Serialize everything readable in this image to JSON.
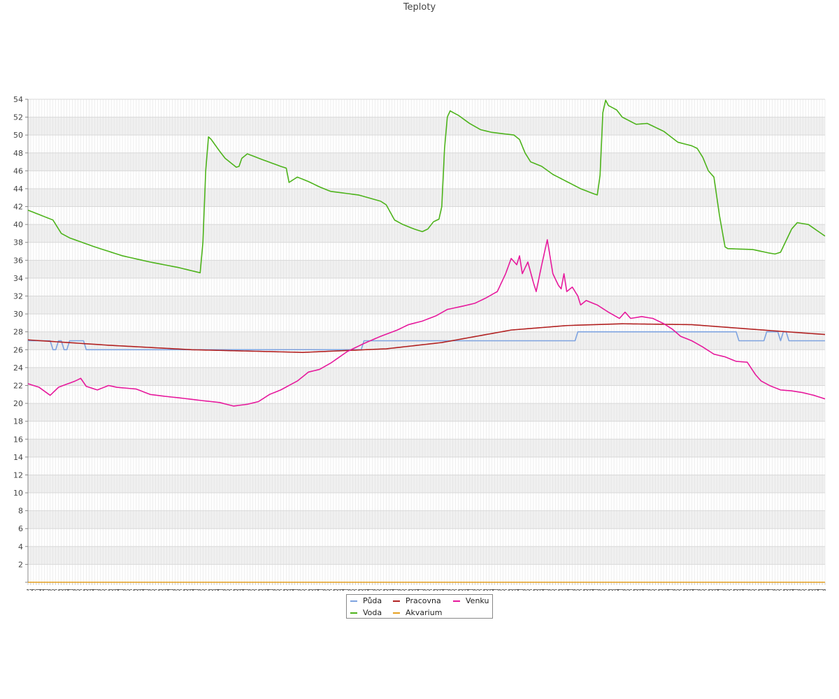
{
  "chart_data": {
    "type": "line",
    "title": "Teploty",
    "xlabel": "",
    "ylabel": "",
    "ylim": [
      0,
      54
    ],
    "y_ticks": [
      2,
      4,
      6,
      8,
      10,
      12,
      14,
      16,
      18,
      20,
      22,
      24,
      26,
      28,
      30,
      32,
      34,
      36,
      38,
      40,
      42,
      44,
      46,
      48,
      50,
      52,
      54
    ],
    "x_ticks": [
      "1",
      "3",
      "5",
      "6",
      "7",
      "8"
    ],
    "x_count": 288,
    "grid": true,
    "legend_position": "bottom",
    "series": [
      {
        "name": "Půda",
        "color": "#7ea3e0",
        "anchors": [
          [
            1,
            27
          ],
          [
            9,
            27
          ],
          [
            10,
            26
          ],
          [
            11,
            26
          ],
          [
            12,
            27
          ],
          [
            13,
            27
          ],
          [
            14,
            26
          ],
          [
            15,
            26
          ],
          [
            16,
            27
          ],
          [
            21,
            27
          ],
          [
            22,
            26
          ],
          [
            121,
            26
          ],
          [
            122,
            27
          ],
          [
            198,
            27
          ],
          [
            199,
            28
          ],
          [
            256,
            28
          ],
          [
            257,
            27
          ],
          [
            266,
            27
          ],
          [
            267,
            28
          ],
          [
            271,
            28
          ],
          [
            272,
            27
          ],
          [
            273,
            28
          ],
          [
            274,
            28
          ],
          [
            275,
            27
          ],
          [
            288,
            27
          ]
        ]
      },
      {
        "name": "Pracovna",
        "color": "#b22222",
        "anchors": [
          [
            1,
            27.1
          ],
          [
            30,
            26.5
          ],
          [
            60,
            26
          ],
          [
            100,
            25.7
          ],
          [
            130,
            26.1
          ],
          [
            150,
            26.8
          ],
          [
            175,
            28.2
          ],
          [
            195,
            28.7
          ],
          [
            215,
            28.9
          ],
          [
            240,
            28.8
          ],
          [
            270,
            28.1
          ],
          [
            288,
            27.7
          ]
        ]
      },
      {
        "name": "Venku",
        "color": "#e6199c",
        "anchors": [
          [
            1,
            22.2
          ],
          [
            5,
            21.8
          ],
          [
            9,
            20.9
          ],
          [
            12,
            21.8
          ],
          [
            18,
            22.5
          ],
          [
            20,
            22.8
          ],
          [
            22,
            21.9
          ],
          [
            26,
            21.5
          ],
          [
            30,
            22
          ],
          [
            33,
            21.8
          ],
          [
            40,
            21.6
          ],
          [
            45,
            21
          ],
          [
            50,
            20.8
          ],
          [
            56,
            20.6
          ],
          [
            64,
            20.3
          ],
          [
            70,
            20.1
          ],
          [
            75,
            19.7
          ],
          [
            80,
            19.9
          ],
          [
            84,
            20.2
          ],
          [
            88,
            21
          ],
          [
            92,
            21.5
          ],
          [
            98,
            22.5
          ],
          [
            102,
            23.5
          ],
          [
            106,
            23.8
          ],
          [
            110,
            24.5
          ],
          [
            116,
            25.8
          ],
          [
            122,
            26.7
          ],
          [
            128,
            27.5
          ],
          [
            134,
            28.2
          ],
          [
            138,
            28.8
          ],
          [
            143,
            29.2
          ],
          [
            148,
            29.8
          ],
          [
            152,
            30.5
          ],
          [
            158,
            30.9
          ],
          [
            162,
            31.2
          ],
          [
            166,
            31.8
          ],
          [
            170,
            32.5
          ],
          [
            173,
            34.5
          ],
          [
            175,
            36.2
          ],
          [
            177,
            35.5
          ],
          [
            178,
            36.5
          ],
          [
            179,
            34.5
          ],
          [
            181,
            35.8
          ],
          [
            183,
            33.5
          ],
          [
            184,
            32.5
          ],
          [
            186,
            35.5
          ],
          [
            188,
            38.3
          ],
          [
            190,
            34.5
          ],
          [
            192,
            33.2
          ],
          [
            193,
            32.8
          ],
          [
            194,
            34.5
          ],
          [
            195,
            32.5
          ],
          [
            197,
            33
          ],
          [
            199,
            32
          ],
          [
            200,
            31
          ],
          [
            202,
            31.5
          ],
          [
            206,
            31
          ],
          [
            210,
            30.2
          ],
          [
            214,
            29.5
          ],
          [
            216,
            30.2
          ],
          [
            218,
            29.5
          ],
          [
            222,
            29.7
          ],
          [
            226,
            29.5
          ],
          [
            230,
            28.9
          ],
          [
            233,
            28.3
          ],
          [
            236,
            27.5
          ],
          [
            240,
            27
          ],
          [
            244,
            26.3
          ],
          [
            248,
            25.5
          ],
          [
            252,
            25.2
          ],
          [
            256,
            24.7
          ],
          [
            260,
            24.6
          ],
          [
            263,
            23.2
          ],
          [
            265,
            22.5
          ],
          [
            268,
            22
          ],
          [
            272,
            21.5
          ],
          [
            276,
            21.4
          ],
          [
            280,
            21.2
          ],
          [
            284,
            20.9
          ],
          [
            288,
            20.5
          ]
        ]
      },
      {
        "name": "Voda",
        "color": "#4db31b",
        "anchors": [
          [
            1,
            41.6
          ],
          [
            10,
            40.5
          ],
          [
            13,
            39
          ],
          [
            16,
            38.5
          ],
          [
            25,
            37.5
          ],
          [
            35,
            36.5
          ],
          [
            45,
            35.8
          ],
          [
            55,
            35.2
          ],
          [
            63,
            34.6
          ],
          [
            64,
            38
          ],
          [
            65,
            46
          ],
          [
            66,
            49.8
          ],
          [
            67,
            49.5
          ],
          [
            70,
            48.2
          ],
          [
            72,
            47.4
          ],
          [
            76,
            46.4
          ],
          [
            77,
            46.5
          ],
          [
            78,
            47.4
          ],
          [
            80,
            47.9
          ],
          [
            85,
            47.3
          ],
          [
            92,
            46.5
          ],
          [
            94,
            46.3
          ],
          [
            95,
            44.7
          ],
          [
            98,
            45.3
          ],
          [
            102,
            44.8
          ],
          [
            106,
            44.2
          ],
          [
            110,
            43.7
          ],
          [
            120,
            43.3
          ],
          [
            128,
            42.6
          ],
          [
            130,
            42.2
          ],
          [
            133,
            40.5
          ],
          [
            136,
            40
          ],
          [
            140,
            39.5
          ],
          [
            143,
            39.2
          ],
          [
            145,
            39.5
          ],
          [
            147,
            40.3
          ],
          [
            149,
            40.6
          ],
          [
            150,
            42
          ],
          [
            151,
            48.5
          ],
          [
            152,
            52
          ],
          [
            153,
            52.7
          ],
          [
            156,
            52.2
          ],
          [
            160,
            51.3
          ],
          [
            164,
            50.6
          ],
          [
            168,
            50.3
          ],
          [
            176,
            50
          ],
          [
            178,
            49.5
          ],
          [
            180,
            48
          ],
          [
            182,
            47
          ],
          [
            186,
            46.5
          ],
          [
            190,
            45.6
          ],
          [
            195,
            44.8
          ],
          [
            200,
            44
          ],
          [
            205,
            43.4
          ],
          [
            206,
            43.3
          ],
          [
            207,
            45.5
          ],
          [
            208,
            52.5
          ],
          [
            209,
            53.9
          ],
          [
            210,
            53.3
          ],
          [
            213,
            52.8
          ],
          [
            215,
            52
          ],
          [
            220,
            51.2
          ],
          [
            224,
            51.3
          ],
          [
            230,
            50.4
          ],
          [
            235,
            49.2
          ],
          [
            240,
            48.8
          ],
          [
            242,
            48.5
          ],
          [
            244,
            47.5
          ],
          [
            246,
            46
          ],
          [
            248,
            45.3
          ],
          [
            250,
            41
          ],
          [
            252,
            37.5
          ],
          [
            253,
            37.3
          ],
          [
            262,
            37.2
          ],
          [
            268,
            36.8
          ],
          [
            270,
            36.7
          ],
          [
            272,
            36.9
          ],
          [
            274,
            38.2
          ],
          [
            276,
            39.5
          ],
          [
            278,
            40.2
          ],
          [
            282,
            40
          ],
          [
            288,
            38.7
          ]
        ]
      },
      {
        "name": "Akvarium",
        "color": "#e6a020",
        "anchors": [
          [
            1,
            0
          ],
          [
            288,
            0
          ]
        ]
      }
    ]
  }
}
